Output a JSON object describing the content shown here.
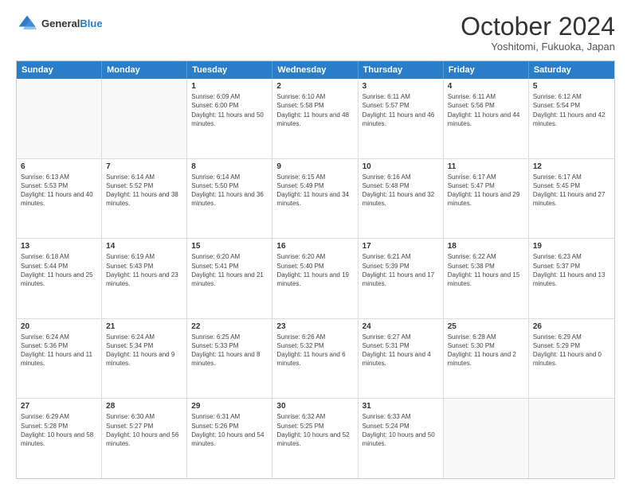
{
  "header": {
    "logo_line1": "General",
    "logo_line2": "Blue",
    "month_title": "October 2024",
    "location": "Yoshitomi, Fukuoka, Japan"
  },
  "days_of_week": [
    "Sunday",
    "Monday",
    "Tuesday",
    "Wednesday",
    "Thursday",
    "Friday",
    "Saturday"
  ],
  "weeks": [
    [
      {
        "day": "",
        "text": "",
        "empty": true
      },
      {
        "day": "",
        "text": "",
        "empty": true
      },
      {
        "day": "1",
        "text": "Sunrise: 6:09 AM\nSunset: 6:00 PM\nDaylight: 11 hours and 50 minutes."
      },
      {
        "day": "2",
        "text": "Sunrise: 6:10 AM\nSunset: 5:58 PM\nDaylight: 11 hours and 48 minutes."
      },
      {
        "day": "3",
        "text": "Sunrise: 6:11 AM\nSunset: 5:57 PM\nDaylight: 11 hours and 46 minutes."
      },
      {
        "day": "4",
        "text": "Sunrise: 6:11 AM\nSunset: 5:56 PM\nDaylight: 11 hours and 44 minutes."
      },
      {
        "day": "5",
        "text": "Sunrise: 6:12 AM\nSunset: 5:54 PM\nDaylight: 11 hours and 42 minutes."
      }
    ],
    [
      {
        "day": "6",
        "text": "Sunrise: 6:13 AM\nSunset: 5:53 PM\nDaylight: 11 hours and 40 minutes."
      },
      {
        "day": "7",
        "text": "Sunrise: 6:14 AM\nSunset: 5:52 PM\nDaylight: 11 hours and 38 minutes."
      },
      {
        "day": "8",
        "text": "Sunrise: 6:14 AM\nSunset: 5:50 PM\nDaylight: 11 hours and 36 minutes."
      },
      {
        "day": "9",
        "text": "Sunrise: 6:15 AM\nSunset: 5:49 PM\nDaylight: 11 hours and 34 minutes."
      },
      {
        "day": "10",
        "text": "Sunrise: 6:16 AM\nSunset: 5:48 PM\nDaylight: 11 hours and 32 minutes."
      },
      {
        "day": "11",
        "text": "Sunrise: 6:17 AM\nSunset: 5:47 PM\nDaylight: 11 hours and 29 minutes."
      },
      {
        "day": "12",
        "text": "Sunrise: 6:17 AM\nSunset: 5:45 PM\nDaylight: 11 hours and 27 minutes."
      }
    ],
    [
      {
        "day": "13",
        "text": "Sunrise: 6:18 AM\nSunset: 5:44 PM\nDaylight: 11 hours and 25 minutes."
      },
      {
        "day": "14",
        "text": "Sunrise: 6:19 AM\nSunset: 5:43 PM\nDaylight: 11 hours and 23 minutes."
      },
      {
        "day": "15",
        "text": "Sunrise: 6:20 AM\nSunset: 5:41 PM\nDaylight: 11 hours and 21 minutes."
      },
      {
        "day": "16",
        "text": "Sunrise: 6:20 AM\nSunset: 5:40 PM\nDaylight: 11 hours and 19 minutes."
      },
      {
        "day": "17",
        "text": "Sunrise: 6:21 AM\nSunset: 5:39 PM\nDaylight: 11 hours and 17 minutes."
      },
      {
        "day": "18",
        "text": "Sunrise: 6:22 AM\nSunset: 5:38 PM\nDaylight: 11 hours and 15 minutes."
      },
      {
        "day": "19",
        "text": "Sunrise: 6:23 AM\nSunset: 5:37 PM\nDaylight: 11 hours and 13 minutes."
      }
    ],
    [
      {
        "day": "20",
        "text": "Sunrise: 6:24 AM\nSunset: 5:36 PM\nDaylight: 11 hours and 11 minutes."
      },
      {
        "day": "21",
        "text": "Sunrise: 6:24 AM\nSunset: 5:34 PM\nDaylight: 11 hours and 9 minutes."
      },
      {
        "day": "22",
        "text": "Sunrise: 6:25 AM\nSunset: 5:33 PM\nDaylight: 11 hours and 8 minutes."
      },
      {
        "day": "23",
        "text": "Sunrise: 6:26 AM\nSunset: 5:32 PM\nDaylight: 11 hours and 6 minutes."
      },
      {
        "day": "24",
        "text": "Sunrise: 6:27 AM\nSunset: 5:31 PM\nDaylight: 11 hours and 4 minutes."
      },
      {
        "day": "25",
        "text": "Sunrise: 6:28 AM\nSunset: 5:30 PM\nDaylight: 11 hours and 2 minutes."
      },
      {
        "day": "26",
        "text": "Sunrise: 6:29 AM\nSunset: 5:29 PM\nDaylight: 11 hours and 0 minutes."
      }
    ],
    [
      {
        "day": "27",
        "text": "Sunrise: 6:29 AM\nSunset: 5:28 PM\nDaylight: 10 hours and 58 minutes."
      },
      {
        "day": "28",
        "text": "Sunrise: 6:30 AM\nSunset: 5:27 PM\nDaylight: 10 hours and 56 minutes."
      },
      {
        "day": "29",
        "text": "Sunrise: 6:31 AM\nSunset: 5:26 PM\nDaylight: 10 hours and 54 minutes."
      },
      {
        "day": "30",
        "text": "Sunrise: 6:32 AM\nSunset: 5:25 PM\nDaylight: 10 hours and 52 minutes."
      },
      {
        "day": "31",
        "text": "Sunrise: 6:33 AM\nSunset: 5:24 PM\nDaylight: 10 hours and 50 minutes."
      },
      {
        "day": "",
        "text": "",
        "empty": true
      },
      {
        "day": "",
        "text": "",
        "empty": true
      }
    ]
  ]
}
